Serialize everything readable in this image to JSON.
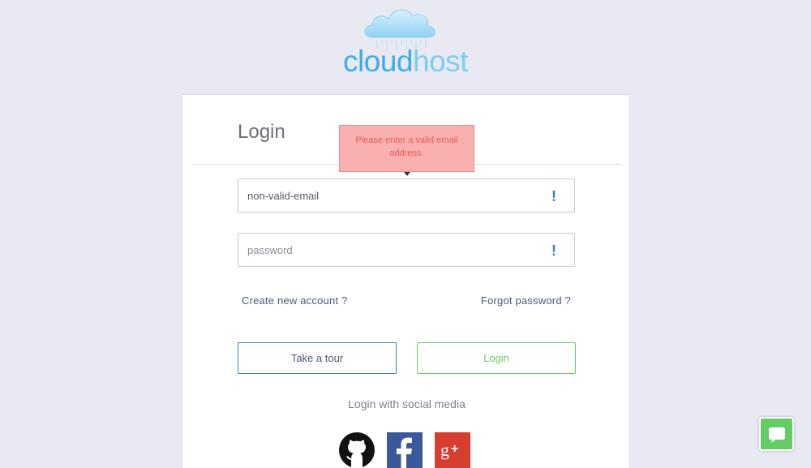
{
  "brand": {
    "name_dark": "cloud",
    "name_light": "host"
  },
  "login_card": {
    "title": "Login",
    "tooltip": "Please enter a valid email address.",
    "email": {
      "value": "non-valid-email",
      "warning": "!"
    },
    "password": {
      "placeholder": "password",
      "warning": "!"
    },
    "create_account_link": "Create new account ?",
    "forgot_password_link": "Forgot password ?",
    "tour_button": "Take a tour",
    "login_button": "Login",
    "social_label": "Login with social media",
    "social_buttons": [
      {
        "icon": "github-icon"
      },
      {
        "icon": "facebook-icon"
      },
      {
        "icon": "google-plus-icon"
      }
    ]
  },
  "colors": {
    "background": "#e9e9f3",
    "brand_blue": "#3aaee8",
    "tooltip_bg": "#fbb0b0",
    "tooltip_text": "#e45a5a",
    "login_green": "#6cc76c",
    "tour_blue": "#3d7fc0",
    "facebook": "#3b5998",
    "google": "#d63e2f",
    "chat_green": "#66cc66"
  }
}
